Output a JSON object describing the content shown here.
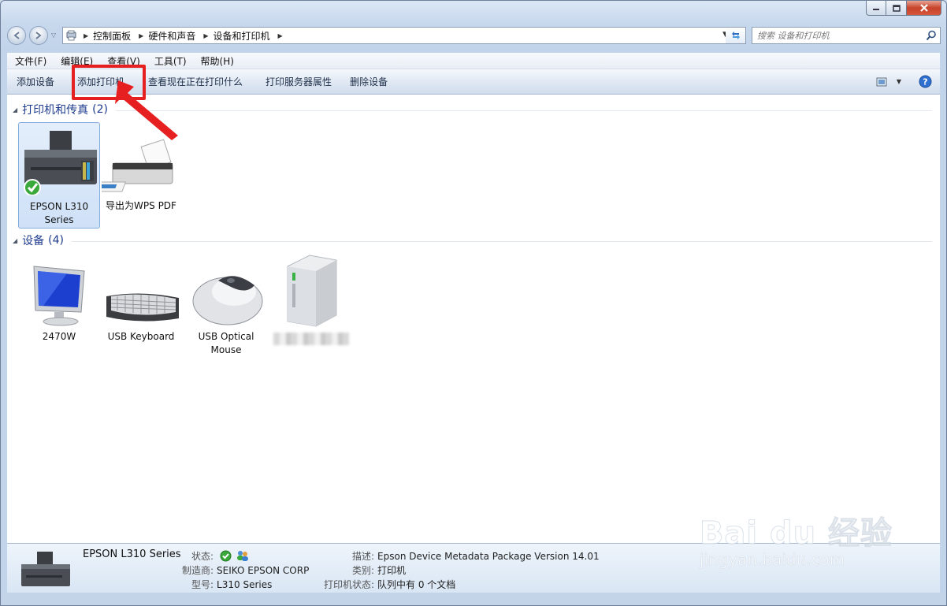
{
  "window": {
    "min_label": "minimize",
    "max_label": "maximize",
    "close_label": "close"
  },
  "address_bar": {
    "breadcrumbs": [
      "控制面板",
      "硬件和声音",
      "设备和打印机"
    ]
  },
  "search": {
    "placeholder": "搜索 设备和打印机"
  },
  "menu": {
    "items": [
      "文件(F)",
      "编辑(E)",
      "查看(V)",
      "工具(T)",
      "帮助(H)"
    ]
  },
  "commands": {
    "items": [
      "添加设备",
      "添加打印机",
      "查看现在正在打印什么",
      "打印服务器属性",
      "删除设备"
    ]
  },
  "groups": {
    "printers": {
      "title": "打印机和传真",
      "count": "(2)",
      "items": [
        {
          "label": "EPSON L310 Series",
          "icon": "printer-inkjet-icon",
          "default": true
        },
        {
          "label": "导出为WPS PDF",
          "icon": "printer-icon",
          "default": false
        }
      ]
    },
    "devices": {
      "title": "设备",
      "count": "(4)",
      "items": [
        {
          "label": "2470W",
          "icon": "monitor-icon"
        },
        {
          "label": "USB Keyboard",
          "icon": "keyboard-icon"
        },
        {
          "label": "USB Optical Mouse",
          "icon": "mouse-icon"
        },
        {
          "label": "",
          "icon": "computer-tower-icon"
        }
      ]
    }
  },
  "details": {
    "name": "EPSON L310 Series",
    "status_key": "状态:",
    "manufacturer_key": "制造商:",
    "manufacturer": "SEIKO EPSON CORP",
    "model_key": "型号:",
    "model": "L310 Series",
    "description_key": "描述:",
    "description": "Epson Device Metadata Package Version 14.01",
    "category_key": "类别:",
    "category": "打印机",
    "printer_status_key": "打印机状态:",
    "printer_status": "队列中有 0 个文档"
  },
  "watermark": {
    "main": "Bai du 经验",
    "sub": "jingyan.baidu.com"
  },
  "colors": {
    "accent_red": "#e62020",
    "group_title": "#1e3c8e"
  }
}
